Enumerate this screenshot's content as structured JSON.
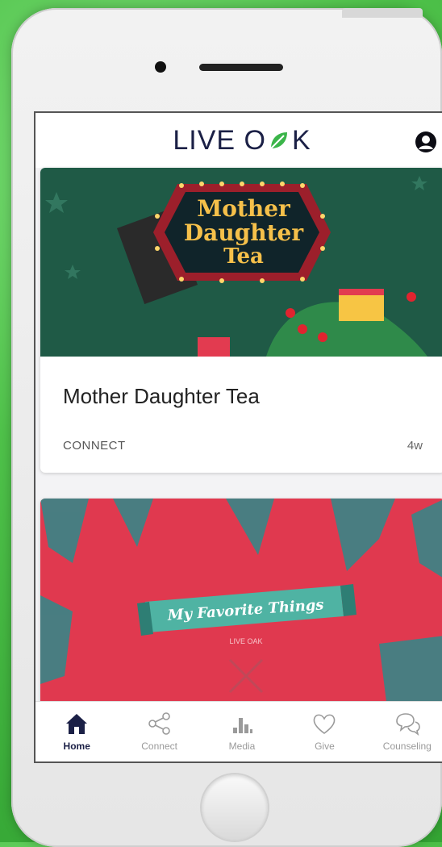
{
  "app": {
    "logo_text_left": "LIVE O",
    "logo_text_right": "K",
    "profile_icon": "user-circle-icon"
  },
  "feed": [
    {
      "banner_text_line1": "Mother",
      "banner_text_line2": "Daughter",
      "banner_text_line3": "Tea",
      "title": "Mother Daughter Tea",
      "category": "CONNECT",
      "age": "4w"
    },
    {
      "banner_text": "My Favorite Things",
      "banner_subtitle": "LIVE OAK"
    }
  ],
  "tabs": [
    {
      "label": "Home",
      "icon": "home-icon",
      "active": true
    },
    {
      "label": "Connect",
      "icon": "share-icon",
      "active": false
    },
    {
      "label": "Media",
      "icon": "media-bars-icon",
      "active": false
    },
    {
      "label": "Give",
      "icon": "heart-icon",
      "active": false
    },
    {
      "label": "Counseling",
      "icon": "chat-bubbles-icon",
      "active": false
    }
  ],
  "colors": {
    "brand_navy": "#1b2046",
    "leaf_green": "#3bb54a",
    "banner1_bg": "#1f5a46",
    "banner2_bg": "#e0394f",
    "inactive_tab": "#9a9a9a"
  }
}
